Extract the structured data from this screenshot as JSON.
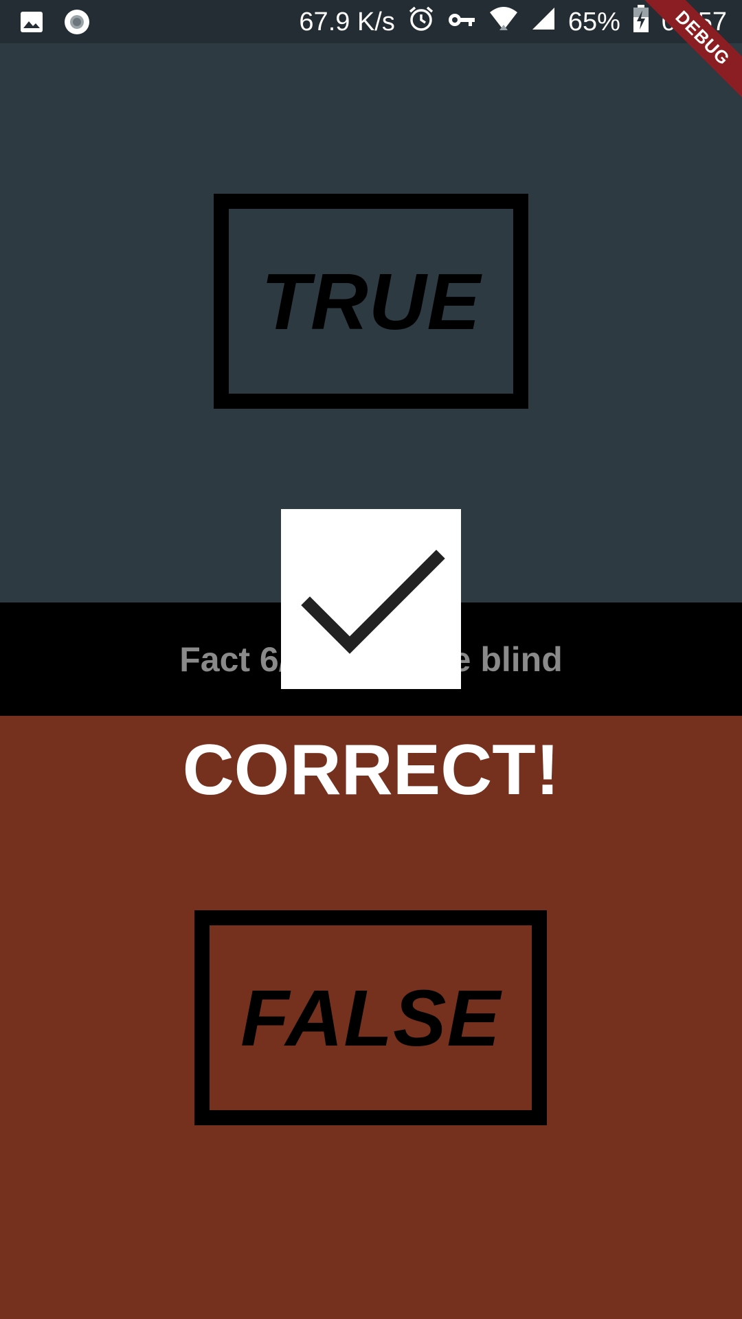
{
  "status_bar": {
    "network_speed": "67.9 K/s",
    "battery_percent": "65%",
    "time": "01:57",
    "icons": [
      "image-icon",
      "record-icon",
      "alarm-icon",
      "vpn-key-icon",
      "wifi-icon",
      "cell-signal-icon",
      "battery-charging-icon"
    ]
  },
  "debug_banner": "DEBUG",
  "quiz": {
    "true_label": "TRUE",
    "false_label": "FALSE",
    "fact_text": "Fact 6/",
    "fact_text_tail": "e blind",
    "result_text": "CORRECT!",
    "result_icon": "checkmark-icon"
  },
  "colors": {
    "status_bar": "#232d33",
    "true_panel": "#2e3a42",
    "false_panel": "#75311e",
    "fact_strip": "#000000",
    "debug_ribbon": "#8b1e22",
    "fact_text": "#8a8a8a"
  }
}
